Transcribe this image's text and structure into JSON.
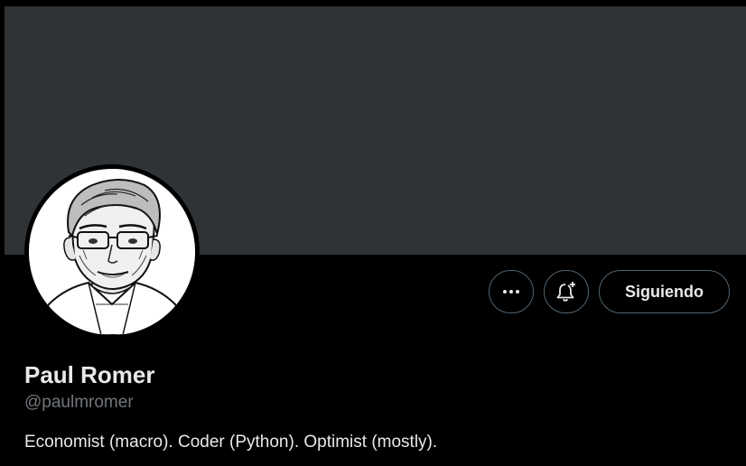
{
  "profile": {
    "display_name": "Paul Romer",
    "handle": "@paulmromer",
    "bio": "Economist (macro). Coder (Python). Optimist (mostly)."
  },
  "actions": {
    "more_icon": "ellipsis-icon",
    "notify_icon": "bell-plus-icon",
    "follow_label": "Siguiendo"
  },
  "colors": {
    "background": "#000000",
    "banner": "#2f3336",
    "text_primary": "#e7e9ea",
    "text_secondary": "#71767b",
    "button_border": "#536471"
  }
}
